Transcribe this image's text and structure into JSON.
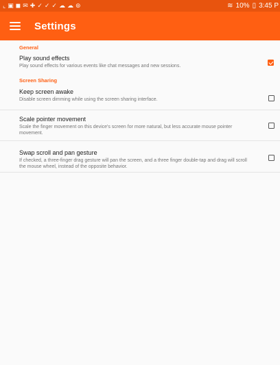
{
  "status_bar": {
    "left_icons": [
      "screenshot-icon",
      "image-icon",
      "media-icon",
      "mail-icon",
      "shield-icon",
      "check-icon",
      "check-icon",
      "check-icon",
      "cloud-icon",
      "cloud-icon",
      "sync-icon"
    ],
    "battery": "10%",
    "time": "3:45 P"
  },
  "app_bar": {
    "title": "Settings"
  },
  "sections": [
    {
      "header": "General",
      "items": [
        {
          "title": "Play sound effects",
          "summary": "Play sound effects for various events like chat messages and new sessions.",
          "checked": true
        }
      ]
    },
    {
      "header": "Screen Sharing",
      "items": [
        {
          "title": "Keep screen awake",
          "summary": "Disable screen dimming while using the screen sharing interface.",
          "checked": false
        },
        {
          "title": "Scale pointer movement",
          "summary": "Scale the finger movement on this device's screen for more natural, but less accurate mouse pointer movement.",
          "checked": false
        },
        {
          "title": "Swap scroll and pan gesture",
          "summary": "If checked, a three-finger drag gesture will pan the screen, and a three finger double-tap and drag will scroll the mouse wheel, instead of the opposite behavior.",
          "checked": false
        }
      ]
    }
  ],
  "colors": {
    "accent": "#ff5f12",
    "status_bar": "#e8540e"
  }
}
